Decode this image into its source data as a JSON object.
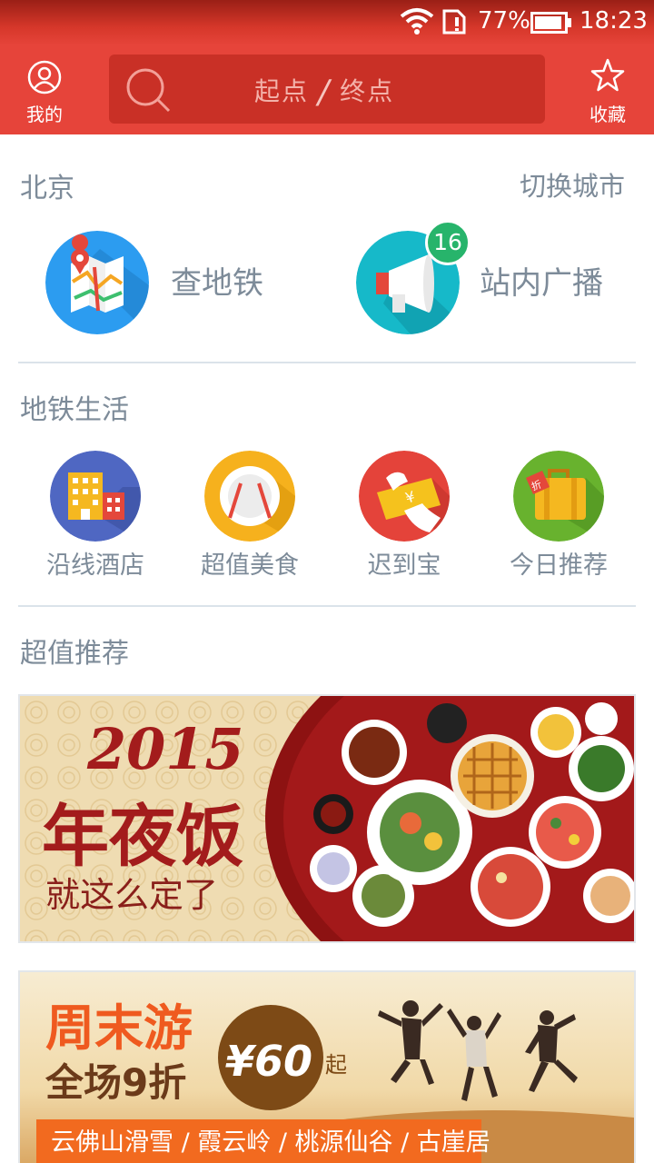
{
  "status_bar": {
    "battery": "77%",
    "time": "18:23"
  },
  "header": {
    "profile_label": "我的",
    "start_placeholder": "起点",
    "separator": "/",
    "end_placeholder": "终点",
    "favorites_label": "收藏"
  },
  "city": {
    "name": "北京",
    "switch_label": "切换城市"
  },
  "main_entries": [
    {
      "label": "查地铁",
      "icon": "subway-map-icon"
    },
    {
      "label": "站内广播",
      "icon": "megaphone-icon",
      "badge": "16"
    }
  ],
  "metro_life": {
    "title": "地铁生活",
    "items": [
      {
        "label": "沿线酒店",
        "icon": "hotel-icon"
      },
      {
        "label": "超值美食",
        "icon": "food-plate-icon"
      },
      {
        "label": "迟到宝",
        "icon": "money-card-icon"
      },
      {
        "label": "今日推荐",
        "icon": "suitcase-discount-icon"
      }
    ]
  },
  "recommend": {
    "title": "超值推荐",
    "banners": [
      {
        "year": "2015",
        "headline": "年夜饭",
        "subline": "就这么定了"
      },
      {
        "headline": "周末游",
        "subline": "全场9折",
        "price": "¥60",
        "price_suffix": "起",
        "destinations": "云佛山滑雪 / 霞云岭 / 桃源仙谷 / 古崖居"
      }
    ]
  },
  "colors": {
    "brand_red": "#e6443a",
    "text_gray": "#7d8b99",
    "badge_green": "#27b46b",
    "banner_accent": "#f26a1f"
  }
}
